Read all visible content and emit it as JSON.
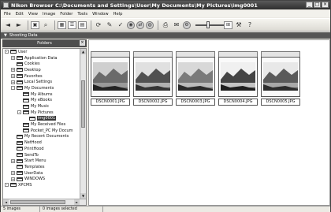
{
  "window": {
    "title": "Nikon Browser C:\\Documents and Settings\\User\\My Documents\\My Pictures\\img0001",
    "controls": [
      "_",
      "□",
      "×"
    ]
  },
  "menu": [
    "File",
    "Edit",
    "View",
    "Image",
    "Folder",
    "Tools",
    "Window",
    "Help"
  ],
  "toolbar": {
    "icons": [
      "back-icon",
      "forward-icon",
      "up-folder-icon",
      "search-icon",
      "view-large-icon",
      "view-list-icon",
      "view-detail-icon",
      "rotate-icon",
      "edit-icon",
      "check-icon",
      "scan-icon",
      "transfer-icon",
      "print-icon",
      "mail-icon",
      "settings-icon",
      "help-icon"
    ],
    "zoom_slider_value": 0.45
  },
  "infobar": {
    "label": "Shooting Data"
  },
  "folders_panel": {
    "title": "Folders",
    "items": [
      {
        "label": "User",
        "indent": 0,
        "exp": "-"
      },
      {
        "label": "Application Data",
        "indent": 1,
        "exp": "+"
      },
      {
        "label": "Cookies",
        "indent": 1,
        "exp": ""
      },
      {
        "label": "Desktop",
        "indent": 1,
        "exp": "+"
      },
      {
        "label": "Favorites",
        "indent": 1,
        "exp": "+"
      },
      {
        "label": "Local Settings",
        "indent": 1,
        "exp": "+"
      },
      {
        "label": "My Documents",
        "indent": 1,
        "exp": "-"
      },
      {
        "label": "My Albums",
        "indent": 2,
        "exp": ""
      },
      {
        "label": "My eBooks",
        "indent": 2,
        "exp": ""
      },
      {
        "label": "My Music",
        "indent": 2,
        "exp": ""
      },
      {
        "label": "My Pictures",
        "indent": 2,
        "exp": "-"
      },
      {
        "label": "img0001",
        "indent": 3,
        "exp": "",
        "selected": true
      },
      {
        "label": "My Received Files",
        "indent": 2,
        "exp": ""
      },
      {
        "label": "Pocket_PC My Docum",
        "indent": 2,
        "exp": ""
      },
      {
        "label": "My Recent Documents",
        "indent": 1,
        "exp": ""
      },
      {
        "label": "NetHood",
        "indent": 1,
        "exp": ""
      },
      {
        "label": "PrintHood",
        "indent": 1,
        "exp": ""
      },
      {
        "label": "SendTo",
        "indent": 1,
        "exp": ""
      },
      {
        "label": "Start Menu",
        "indent": 1,
        "exp": "+"
      },
      {
        "label": "Templates",
        "indent": 1,
        "exp": ""
      },
      {
        "label": "UserData",
        "indent": 1,
        "exp": "+"
      },
      {
        "label": "WINDOWS",
        "indent": 1,
        "exp": "+"
      },
      {
        "label": "XPCMS",
        "indent": 0,
        "exp": "-"
      }
    ]
  },
  "images": [
    {
      "filename": "DSCN0001.JPG"
    },
    {
      "filename": "DSCN0002.JPG"
    },
    {
      "filename": "DSCN0003.JPG"
    },
    {
      "filename": "DSCN0004.JPG"
    },
    {
      "filename": "DSCN0005.JPG"
    }
  ],
  "status": {
    "count": "5 images",
    "selected": "0 images selected"
  }
}
